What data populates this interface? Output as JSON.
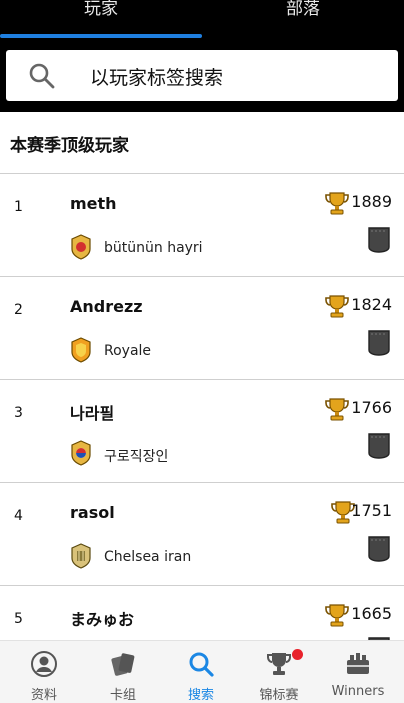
{
  "tabs": [
    {
      "label": "玩家",
      "active": true
    },
    {
      "label": "部落",
      "active": false
    }
  ],
  "search": {
    "placeholder": "以玩家标签搜索"
  },
  "section_title": "本赛季顶级玩家",
  "players": [
    {
      "rank": "1",
      "name": "meth",
      "clan": "bütünün hayri",
      "trophies": "1889",
      "badge": "red"
    },
    {
      "rank": "2",
      "name": "Andrezz",
      "clan": "Royale",
      "trophies": "1824",
      "badge": "orange"
    },
    {
      "rank": "3",
      "name": "나라필",
      "clan": "구로직장인",
      "trophies": "1766",
      "badge": "korea"
    },
    {
      "rank": "4",
      "name": "rasol",
      "clan": "Chelsea iran",
      "trophies": "1751",
      "badge": "gold"
    },
    {
      "rank": "5",
      "name": "まみゅお",
      "clan": "",
      "trophies": "1665",
      "badge": ""
    }
  ],
  "nav": [
    {
      "label": "资料",
      "icon": "profile-icon",
      "active": false
    },
    {
      "label": "卡组",
      "icon": "cards-icon",
      "active": false
    },
    {
      "label": "搜索",
      "icon": "search-icon",
      "active": true
    },
    {
      "label": "锦标赛",
      "icon": "trophy-icon",
      "active": false
    },
    {
      "label": "Winners",
      "icon": "winners-icon",
      "active": false
    }
  ],
  "colors": {
    "accent": "#1b87e4",
    "topbar": "#000000",
    "notification": "#e8222b"
  }
}
